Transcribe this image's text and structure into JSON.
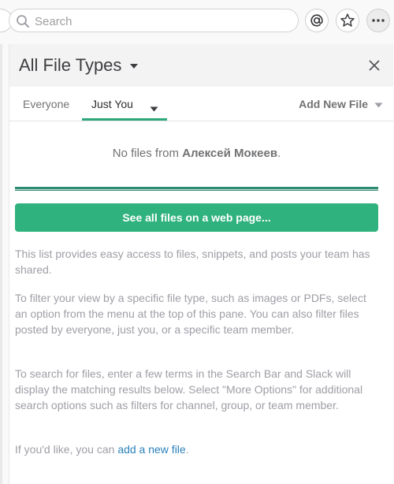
{
  "search": {
    "placeholder": "Search"
  },
  "panel": {
    "title": "All File Types",
    "tabs": [
      {
        "label": "Everyone"
      },
      {
        "label": "Just You"
      }
    ],
    "add_new_file": "Add New File",
    "empty_prefix": "No files from ",
    "empty_user": "Алексей Мокеев",
    "empty_suffix": ".",
    "see_all_button": "See all files on a web page...",
    "paragraphs": [
      "This list provides easy access to files, snippets, and posts your team has shared.",
      "To filter your view by a specific file type, such as images or PDFs, select an option from the menu at the top of this pane. You can also filter files posted by everyone, just you, or a specific team member.",
      "To search for files, enter a few terms in the Search Bar and Slack will display the matching results below. Select \"More Options\" for additional search options such as filters for channel, group, or team member."
    ],
    "footer_prefix": "If you'd like, you can ",
    "footer_link": "add a new file",
    "footer_suffix": "."
  },
  "colors": {
    "accent": "#2fb27d",
    "link": "#2a80b9"
  },
  "icons": [
    "search-icon",
    "at-mention-icon",
    "star-icon",
    "more-icon",
    "caret-down-icon",
    "close-icon"
  ]
}
